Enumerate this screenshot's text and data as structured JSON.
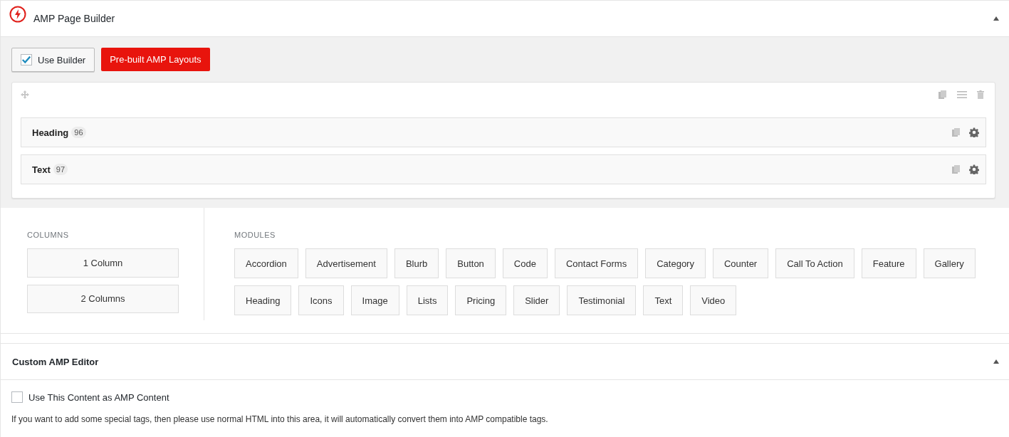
{
  "builder_panel": {
    "title": "AMP Page Builder",
    "expanded": true
  },
  "toolbar": {
    "use_builder": {
      "label": "Use Builder",
      "checked": true
    },
    "layouts_button": "Pre-built AMP Layouts"
  },
  "row_modules": [
    {
      "name": "Heading",
      "count": "96"
    },
    {
      "name": "Text",
      "count": "97"
    }
  ],
  "columns": {
    "heading": "COLUMNS",
    "items": [
      "1 Column",
      "2 Columns"
    ]
  },
  "modules": {
    "heading": "MODULES",
    "items": [
      "Accordion",
      "Advertisement",
      "Blurb",
      "Button",
      "Code",
      "Contact Forms",
      "Category",
      "Counter",
      "Call To Action",
      "Feature",
      "Gallery",
      "Heading",
      "Icons",
      "Image",
      "Lists",
      "Pricing",
      "Slider",
      "Testimonial",
      "Text",
      "Video"
    ]
  },
  "editor_panel": {
    "title": "Custom AMP Editor",
    "expanded": true,
    "use_content": {
      "label": "Use This Content as AMP Content",
      "checked": false
    },
    "note": "If you want to add some special tags, then please use normal HTML into this area, it will automatically convert them into AMP compatible tags."
  }
}
